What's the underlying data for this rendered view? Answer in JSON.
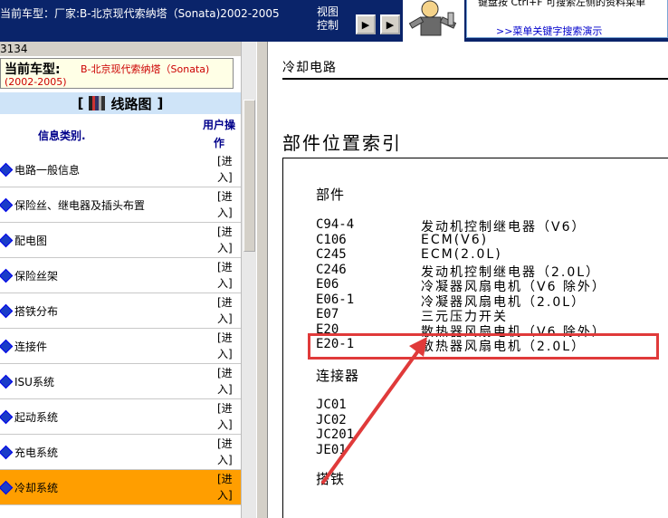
{
  "topbar": {
    "title": "当前车型：厂家:B-北京现代索纳塔（Sonata)2002-2005",
    "view_control_label": "视图控制",
    "prev_button": "▶",
    "next_button": "▶",
    "hint_text": "键盘按   Ctrl+F  可搜索左侧的资料菜单",
    "hint_link": ">>菜单关键字搜索演示"
  },
  "left": {
    "counter": "3134",
    "model_label": "当前车型:",
    "model_value": "B-北京现代索纳塔（Sonata)",
    "model_years": "(2002-2005)",
    "diagram_header_left": "[",
    "diagram_header_text": "线路图",
    "diagram_header_right": "]",
    "col_category": "信息类别.",
    "col_operation": "用户操作",
    "categories": [
      {
        "name": "电路一般信息",
        "action": "[进入]"
      },
      {
        "name": "保险丝、继电器及插头布置",
        "action": "[进入]"
      },
      {
        "name": "配电图",
        "action": "[进入]"
      },
      {
        "name": "保险丝架",
        "action": "[进入]"
      },
      {
        "name": "搭铁分布",
        "action": "[进入]"
      },
      {
        "name": "连接件",
        "action": "[进入]"
      },
      {
        "name": "ISU系统",
        "action": "[进入]"
      },
      {
        "name": "起动系统",
        "action": "[进入]"
      },
      {
        "name": "充电系统",
        "action": "[进入]"
      },
      {
        "name": "冷却系统",
        "action": "[进入]"
      }
    ],
    "active_index": 9
  },
  "right": {
    "section_title": "冷却电路",
    "page_title": "部件位置索引",
    "parts_head": "部件",
    "parts": [
      {
        "code": "C94-4",
        "desc": "发动机控制继电器（V6）"
      },
      {
        "code": "C106",
        "desc": "ECM(V6)"
      },
      {
        "code": "C245",
        "desc": "ECM(2.0L)"
      },
      {
        "code": "C246",
        "desc": "发动机控制继电器（2.0L）"
      },
      {
        "code": "E06",
        "desc": "冷凝器风扇电机（V6 除外）"
      },
      {
        "code": "E06-1",
        "desc": "冷凝器风扇电机（2.0L）"
      },
      {
        "code": "E07",
        "desc": "三元压力开关"
      },
      {
        "code": "E20",
        "desc": "散热器风扇电机（V6 除外）"
      },
      {
        "code": "E20-1",
        "desc": "散热器风扇电机（2.0L）"
      }
    ],
    "connectors_head": "连接器",
    "connectors": [
      "JC01",
      "JC02",
      "JC201",
      "JE01"
    ],
    "ground_head": "搭铁"
  },
  "colors": {
    "active_row": "#ff9e00",
    "highlight_border": "#e03a3a",
    "model_text": "#cc0000"
  }
}
